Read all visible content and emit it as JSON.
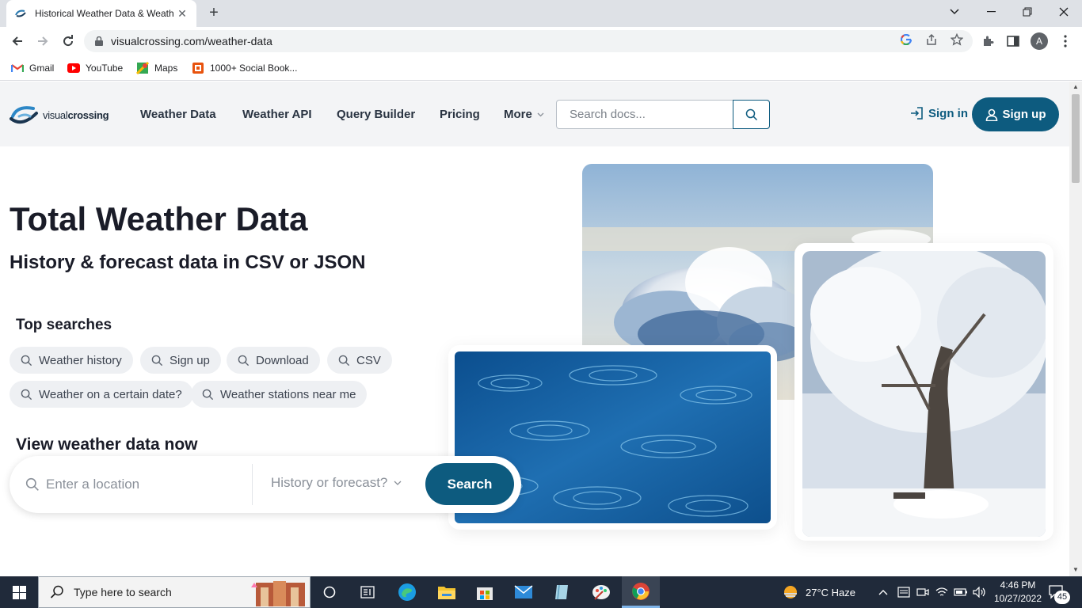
{
  "browser": {
    "tab_title": "Historical Weather Data & Weath",
    "url": "visualcrossing.com/weather-data",
    "avatar_letter": "A",
    "bookmarks": [
      {
        "label": "Gmail"
      },
      {
        "label": "YouTube"
      },
      {
        "label": "Maps"
      },
      {
        "label": "1000+ Social Book..."
      }
    ]
  },
  "site": {
    "logo_part1": "visual",
    "logo_part2": "crossing",
    "nav": [
      {
        "label": "Weather Data"
      },
      {
        "label": "Weather API"
      },
      {
        "label": "Query Builder"
      },
      {
        "label": "Pricing"
      },
      {
        "label": "More"
      }
    ],
    "docs_search_placeholder": "Search docs...",
    "sign_in": "Sign in",
    "sign_up": "Sign up",
    "accent_color": "#0d5b7f"
  },
  "hero": {
    "title": "Total Weather Data",
    "subtitle": "History & forecast data in CSV or JSON",
    "top_searches_heading": "Top searches",
    "chips": [
      {
        "label": "Weather history"
      },
      {
        "label": "Sign up"
      },
      {
        "label": "Download"
      },
      {
        "label": "CSV"
      },
      {
        "label": "Weather on a certain date?"
      },
      {
        "label": "Weather stations near me"
      }
    ],
    "view_now_heading": "View weather data now",
    "location_placeholder": "Enter a location",
    "mode_select": "History or forecast?",
    "search_button": "Search"
  },
  "taskbar": {
    "search_placeholder": "Type here to search",
    "weather": "27°C  Haze",
    "time": "4:46 PM",
    "date": "10/27/2022",
    "notifications": "45"
  }
}
